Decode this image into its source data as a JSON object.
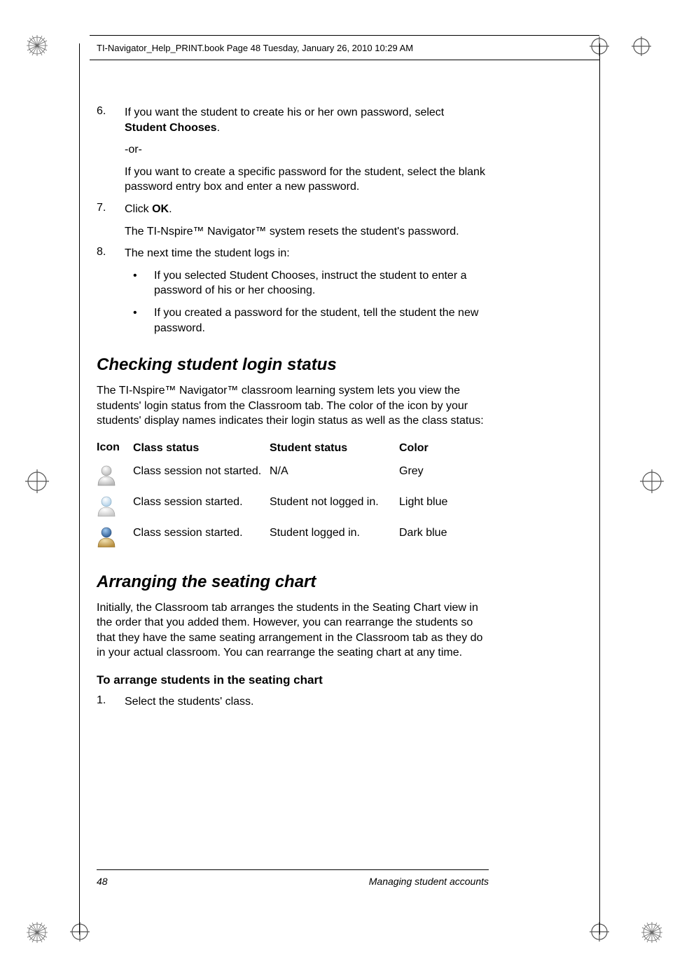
{
  "print_header": "TI-Navigator_Help_PRINT.book  Page 48  Tuesday, January 26, 2010  10:29 AM",
  "steps": {
    "s6_num": "6.",
    "s6_body_prefix": "If you want the student to create his or her own password, select ",
    "s6_body_bold": "Student Chooses",
    "s6_body_suffix": ".",
    "s6_or": "-or-",
    "s6_para2": "If you want to create a specific password for the student, select the blank password entry box and enter a new password.",
    "s7_num": "7.",
    "s7_prefix": "Click ",
    "s7_bold": "OK",
    "s7_suffix": ".",
    "s7_para2": "The TI-Nspire™ Navigator™ system resets the student's password.",
    "s8_num": "8.",
    "s8_body": "The next time the student logs in:",
    "s8_b1": "If you selected Student Chooses, instruct the student to enter a password of his or her choosing.",
    "s8_b2": "If you created a password for the student, tell the student the new password."
  },
  "sections": {
    "h2a": "Checking student login status",
    "p_a": "The TI-Nspire™ Navigator™ classroom learning system lets you view the students' login status from the Classroom tab. The color of the icon by your students' display names indicates their login status as well as the class status:",
    "h2b": "Arranging the seating chart",
    "p_b": "Initially, the Classroom tab arranges the students in the Seating Chart view in the order that you added them. However, you can rearrange the students so that they have the same seating arrangement in the Classroom tab as they do in your actual classroom. You can rearrange the seating chart at any time.",
    "h3": "To arrange students in the seating chart",
    "step1_num": "1.",
    "step1_body": "Select the students' class."
  },
  "table": {
    "h_icon": "Icon",
    "h_class": "Class status",
    "h_student": "Student status",
    "h_color": "Color",
    "r1_class": "Class session not started.",
    "r1_student": "N/A",
    "r1_color": "Grey",
    "r2_class": "Class session started.",
    "r2_student": "Student not logged in.",
    "r2_color": "Light blue",
    "r3_class": "Class session started.",
    "r3_student": "Student logged in.",
    "r3_color": "Dark blue"
  },
  "footer": {
    "page": "48",
    "title": "Managing student accounts"
  },
  "chart_data": {
    "type": "table",
    "columns": [
      "Icon",
      "Class status",
      "Student status",
      "Color"
    ],
    "rows": [
      [
        "grey person icon",
        "Class session not started.",
        "N/A",
        "Grey"
      ],
      [
        "light-blue person icon",
        "Class session started.",
        "Student not logged in.",
        "Light blue"
      ],
      [
        "dark-blue person icon",
        "Class session started.",
        "Student logged in.",
        "Dark blue"
      ]
    ]
  }
}
